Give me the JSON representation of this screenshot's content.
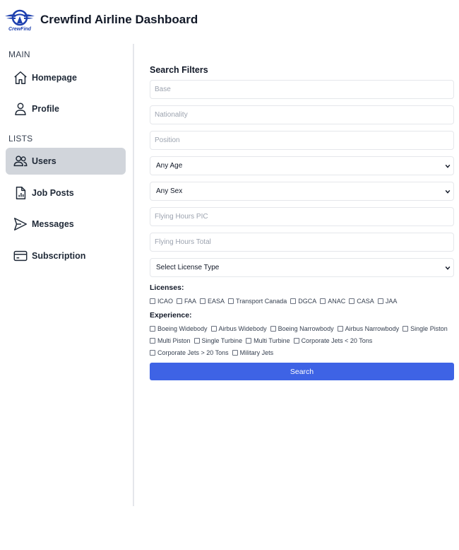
{
  "header": {
    "logo_text": "CrewFind",
    "title": "Crewfind Airline Dashboard"
  },
  "sidebar": {
    "section_main": "MAIN",
    "section_lists": "LISTS",
    "items": [
      {
        "label": "Homepage",
        "icon": "home-icon",
        "active": false
      },
      {
        "label": "Profile",
        "icon": "user-icon",
        "active": false
      },
      {
        "label": "Users",
        "icon": "users-icon",
        "active": true
      },
      {
        "label": "Job Posts",
        "icon": "document-chart-icon",
        "active": false
      },
      {
        "label": "Messages",
        "icon": "send-icon",
        "active": false
      },
      {
        "label": "Subscription",
        "icon": "credit-card-icon",
        "active": false
      }
    ]
  },
  "filters": {
    "title": "Search Filters",
    "base_placeholder": "Base",
    "nationality_placeholder": "Nationality",
    "position_placeholder": "Position",
    "age_selected": "Any Age",
    "sex_selected": "Any Sex",
    "hours_pic_placeholder": "Flying Hours PIC",
    "hours_total_placeholder": "Flying Hours Total",
    "license_type_selected": "Select License Type",
    "licenses_label": "Licenses:",
    "licenses": [
      "ICAO",
      "FAA",
      "EASA",
      "Transport Canada",
      "DGCA",
      "ANAC",
      "CASA",
      "JAA"
    ],
    "experience_label": "Experience:",
    "experience": [
      "Boeing Widebody",
      "Airbus Widebody",
      "Boeing Narrowbody",
      "Airbus Narrowbody",
      "Single Piston",
      "Multi Piston",
      "Single Turbine",
      "Multi Turbine",
      "Corporate Jets < 20 Tons",
      "Corporate Jets > 20 Tons",
      "Military Jets"
    ],
    "search_label": "Search"
  },
  "colors": {
    "accent": "#3e63e5",
    "active_nav": "#d1d5db",
    "logo": "#1e40af"
  }
}
